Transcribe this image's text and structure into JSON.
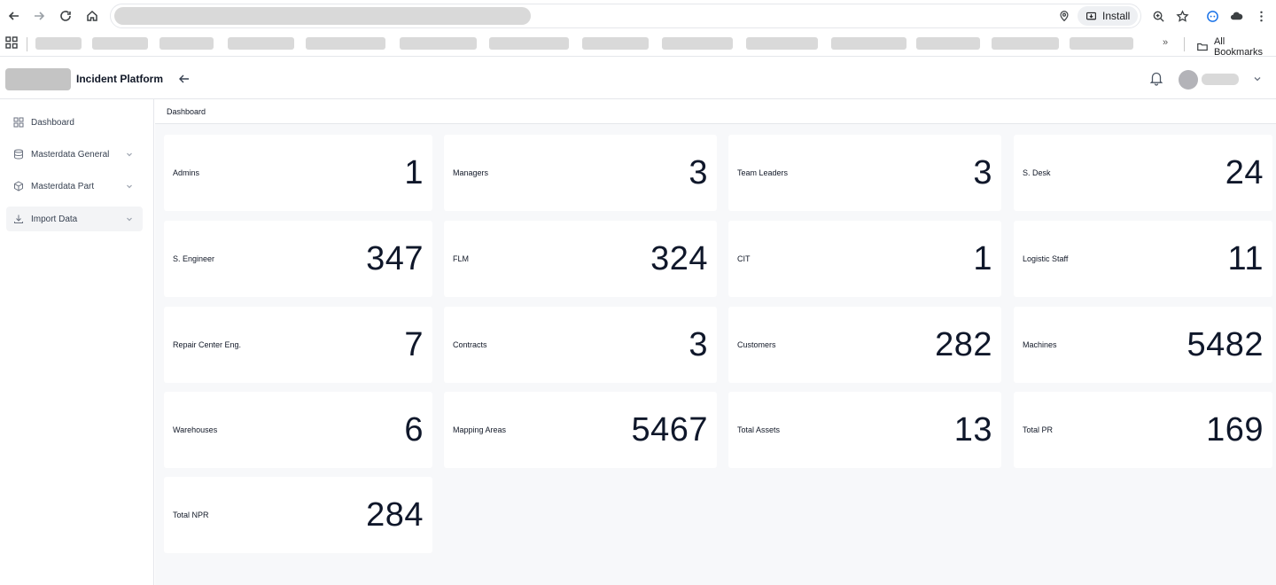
{
  "browser": {
    "install_label": "Install",
    "bookmarks_more": "»",
    "all_bookmarks_label": "All Bookmarks"
  },
  "header": {
    "app_title": "Incident Platform"
  },
  "sidebar": {
    "items": [
      {
        "label": "Dashboard",
        "icon": "grid-icon"
      },
      {
        "label": "Masterdata General",
        "icon": "database-icon"
      },
      {
        "label": "Masterdata Part",
        "icon": "box-icon"
      },
      {
        "label": "Import Data",
        "icon": "download-icon"
      }
    ]
  },
  "main": {
    "breadcrumb": "Dashboard",
    "stats": [
      {
        "label": "Admins",
        "value": "1"
      },
      {
        "label": "Managers",
        "value": "3"
      },
      {
        "label": "Team Leaders",
        "value": "3"
      },
      {
        "label": "S. Desk",
        "value": "24"
      },
      {
        "label": "S. Engineer",
        "value": "347"
      },
      {
        "label": "FLM",
        "value": "324"
      },
      {
        "label": "CIT",
        "value": "1"
      },
      {
        "label": "Logistic Staff",
        "value": "11"
      },
      {
        "label": "Repair Center Eng.",
        "value": "7"
      },
      {
        "label": "Contracts",
        "value": "3"
      },
      {
        "label": "Customers",
        "value": "282"
      },
      {
        "label": "Machines",
        "value": "5482"
      },
      {
        "label": "Warehouses",
        "value": "6"
      },
      {
        "label": "Mapping Areas",
        "value": "5467"
      },
      {
        "label": "Total Assets",
        "value": "13"
      },
      {
        "label": "Total PR",
        "value": "169"
      },
      {
        "label": "Total NPR",
        "value": "284"
      }
    ]
  }
}
